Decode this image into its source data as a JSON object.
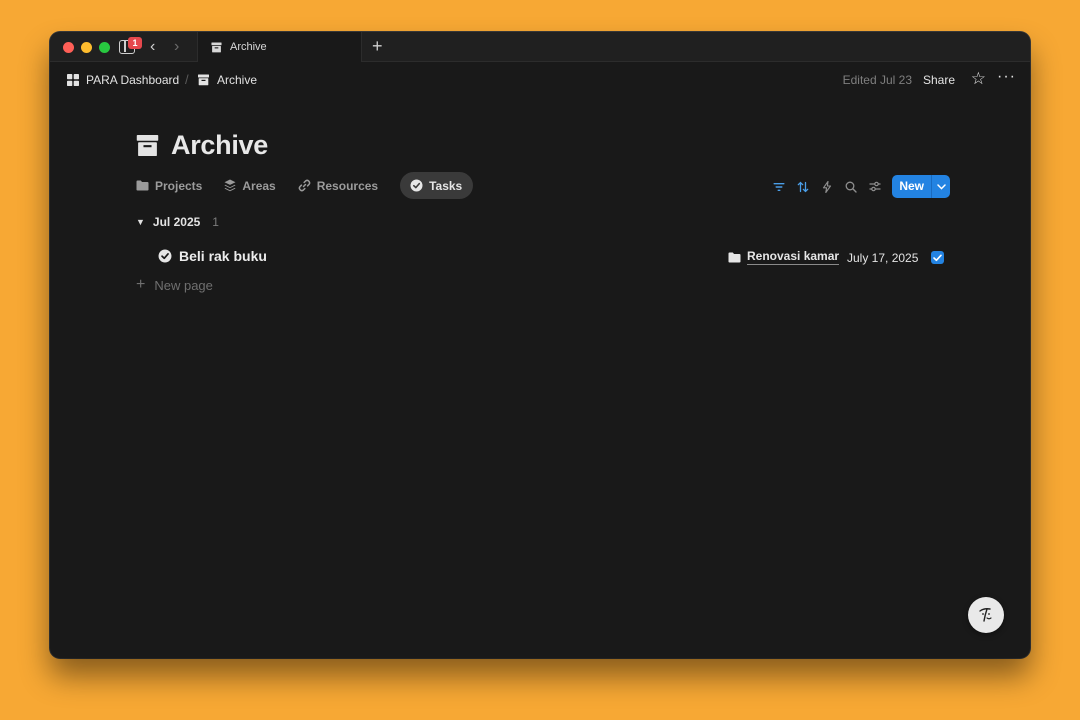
{
  "browser": {
    "notification_count": "1",
    "tab_title": "Archive",
    "new_tab": "+",
    "back": "‹",
    "forward": "›"
  },
  "breadcrumb": {
    "items": [
      "PARA Dashboard",
      "Archive"
    ],
    "separator": "/"
  },
  "header": {
    "edited": "Edited Jul 23",
    "share": "Share",
    "favorite_icon": "☆",
    "more_icon": "···"
  },
  "page": {
    "title": "Archive"
  },
  "views": [
    {
      "label": "Projects",
      "icon": "folder-icon"
    },
    {
      "label": "Areas",
      "icon": "stack-icon"
    },
    {
      "label": "Resources",
      "icon": "link-icon"
    },
    {
      "label": "Tasks",
      "icon": "check-circle-icon",
      "active": true
    }
  ],
  "toolbar": {
    "new_label": "New"
  },
  "group": {
    "toggle": "▼",
    "label": "Jul 2025",
    "count": "1"
  },
  "rows": [
    {
      "title": "Beli rak buku",
      "project": "Renovasi kamar",
      "date": "July 17, 2025",
      "done": true
    }
  ],
  "new_page": {
    "plus": "+",
    "label": "New page"
  },
  "colors": {
    "accent": "#2383e2",
    "background": "#191919",
    "desktop": "#f7a834"
  }
}
